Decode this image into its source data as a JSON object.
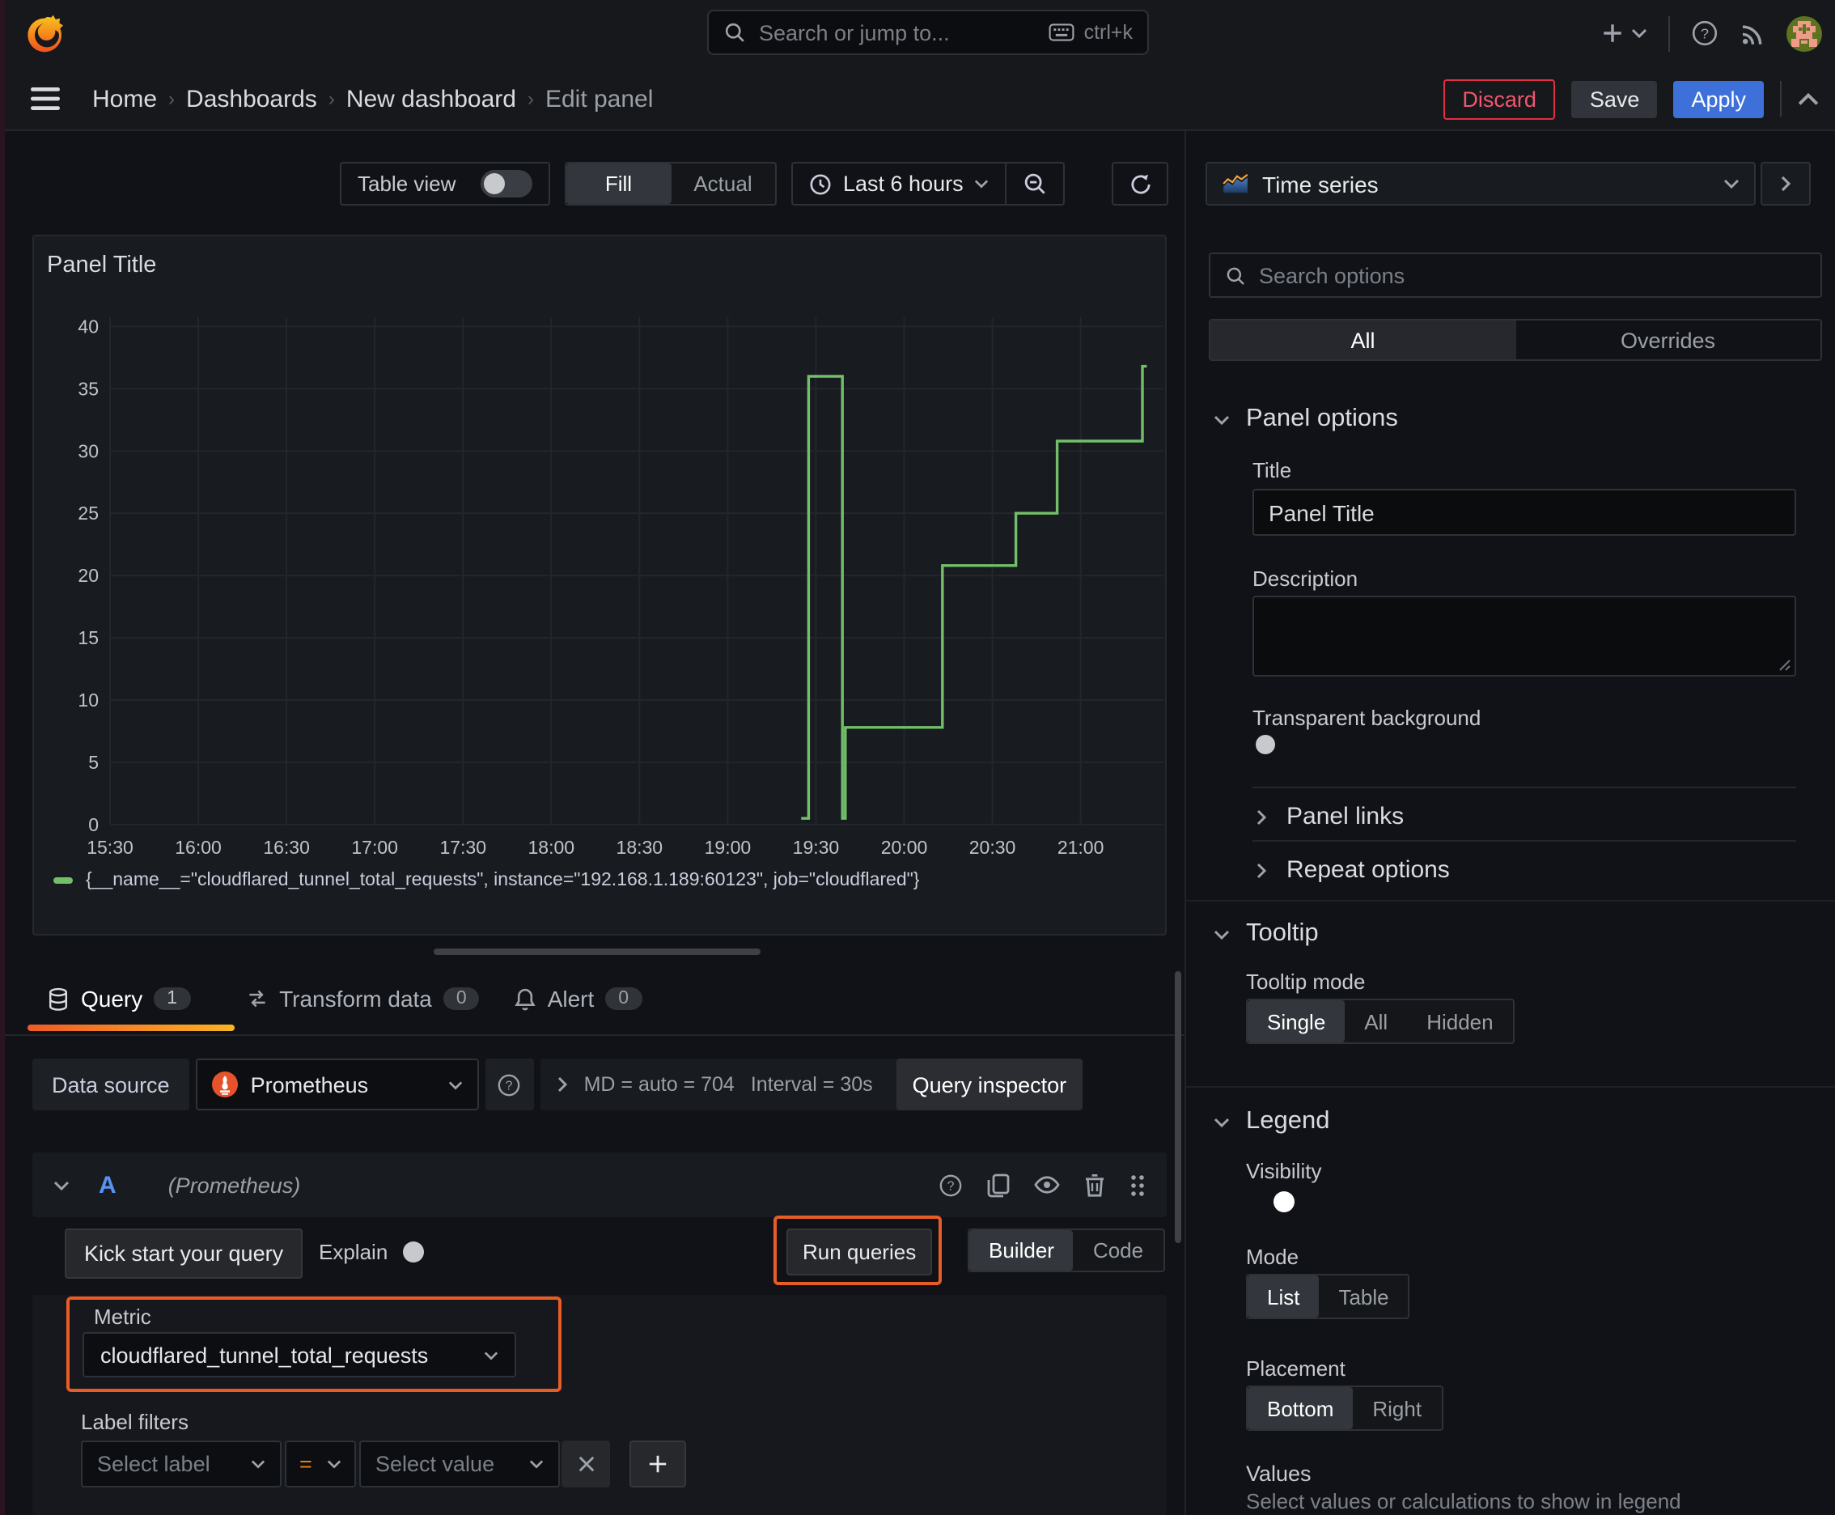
{
  "colors": {
    "series_green": "#73bf69",
    "annotation_orange": "#e85c26",
    "apply_blue": "#3d71d9",
    "discard_red": "#e02f44"
  },
  "topbar": {
    "search_placeholder": "Search or jump to...",
    "search_shortcut": "ctrl+k"
  },
  "breadcrumb": {
    "items": [
      {
        "label": "Home"
      },
      {
        "label": "Dashboards"
      },
      {
        "label": "New dashboard"
      },
      {
        "label": "Edit panel"
      }
    ]
  },
  "header_actions": {
    "discard": "Discard",
    "save": "Save",
    "apply": "Apply"
  },
  "panel_toolbar": {
    "table_view_label": "Table view",
    "display_mode": {
      "fill": "Fill",
      "actual": "Actual",
      "selected": "Fill"
    },
    "time_range": "Last 6 hours"
  },
  "viz_picker": {
    "label": "Time series"
  },
  "options_pane": {
    "search_placeholder": "Search options",
    "tabs": {
      "all": "All",
      "overrides": "Overrides",
      "selected": "All"
    },
    "panel_options": {
      "header": "Panel options",
      "title_label": "Title",
      "title_value": "Panel Title",
      "description_label": "Description",
      "description_value": "",
      "transparent_label": "Transparent background",
      "transparent_on": false
    },
    "panel_links_header": "Panel links",
    "repeat_options_header": "Repeat options",
    "tooltip": {
      "header": "Tooltip",
      "mode_label": "Tooltip mode",
      "modes": [
        "Single",
        "All",
        "Hidden"
      ],
      "selected_mode": "Single"
    },
    "legend": {
      "header": "Legend",
      "visibility_label": "Visibility",
      "visibility_on": true,
      "mode_label": "Mode",
      "modes": [
        "List",
        "Table"
      ],
      "selected_mode": "List",
      "placement_label": "Placement",
      "placements": [
        "Bottom",
        "Right"
      ],
      "selected_placement": "Bottom",
      "values_label": "Values",
      "values_help": "Select values or calculations to show in legend"
    }
  },
  "query_pane": {
    "tabs": [
      {
        "label": "Query",
        "count": "1"
      },
      {
        "label": "Transform data",
        "count": "0"
      },
      {
        "label": "Alert",
        "count": "0"
      }
    ],
    "datasource_label": "Data source",
    "datasource_name": "Prometheus",
    "stats_md": "MD = auto = 704",
    "stats_interval": "Interval = 30s",
    "query_inspector_label": "Query inspector",
    "query_row": {
      "ref_id": "A",
      "hint": "(Prometheus)"
    },
    "kick_start_label": "Kick start your query",
    "explain_label": "Explain",
    "run_queries_label": "Run queries",
    "editor_modes": {
      "builder": "Builder",
      "code": "Code",
      "selected": "Builder"
    },
    "metric": {
      "label": "Metric",
      "value": "cloudflared_tunnel_total_requests"
    },
    "label_filters": {
      "label": "Label filters",
      "select_label_placeholder": "Select label",
      "operator": "=",
      "select_value_placeholder": "Select value"
    }
  },
  "chart_data": {
    "type": "line",
    "title": "Panel Title",
    "x_axis": {
      "tick_labels": [
        "15:30",
        "16:00",
        "16:30",
        "17:00",
        "17:30",
        "18:00",
        "18:30",
        "19:00",
        "19:30",
        "20:00",
        "20:30",
        "21:00"
      ],
      "tick_minutes": [
        0,
        30,
        60,
        90,
        120,
        150,
        180,
        210,
        240,
        270,
        300,
        330
      ],
      "range_minutes": [
        0,
        360
      ]
    },
    "y_axis": {
      "ticks": [
        0,
        5,
        10,
        15,
        20,
        25,
        30,
        35,
        40
      ],
      "range": [
        0,
        41.5
      ]
    },
    "grid": true,
    "legend_position": "bottom",
    "series": [
      {
        "name": "{__name__=\"cloudflared_tunnel_total_requests\", instance=\"192.168.1.189:60123\", job=\"cloudflared\"}",
        "color": "#73bf69",
        "step_vertices_min_val": [
          [
            235,
            0.5
          ],
          [
            237.5,
            0.5
          ],
          [
            237.5,
            36
          ],
          [
            249,
            36
          ],
          [
            249,
            0.5
          ],
          [
            250,
            0.5
          ],
          [
            250,
            7.8
          ],
          [
            283,
            7.8
          ],
          [
            283,
            20.8
          ],
          [
            308,
            20.8
          ],
          [
            308,
            25
          ],
          [
            322,
            25
          ],
          [
            322,
            30.8
          ],
          [
            351,
            30.8
          ],
          [
            351,
            36.8
          ],
          [
            352.5,
            36.8
          ]
        ]
      }
    ]
  }
}
